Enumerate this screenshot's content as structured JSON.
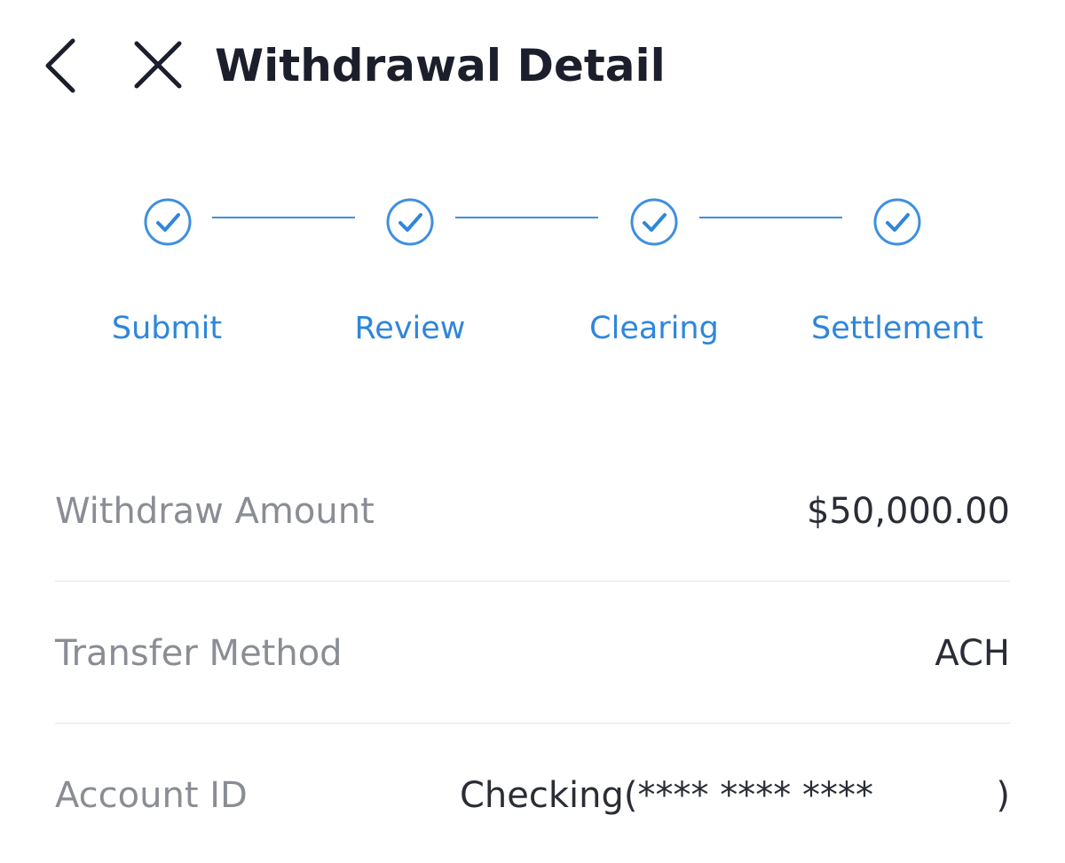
{
  "header": {
    "title": "Withdrawal Detail",
    "back_icon": "chevron-left-icon",
    "close_icon": "close-icon"
  },
  "stepper": {
    "accent_color": "#2f86db",
    "steps": [
      {
        "label": "Submit",
        "status": "completed"
      },
      {
        "label": "Review",
        "status": "completed"
      },
      {
        "label": "Clearing",
        "status": "completed"
      },
      {
        "label": "Settlement",
        "status": "completed"
      }
    ]
  },
  "details": {
    "withdraw_amount": {
      "label": "Withdraw Amount",
      "value": "$50,000.00"
    },
    "transfer_method": {
      "label": "Transfer Method",
      "value": "ACH"
    },
    "account_id": {
      "label": "Account ID",
      "value": "Checking(**** **** ****",
      "value_end": ")"
    }
  }
}
